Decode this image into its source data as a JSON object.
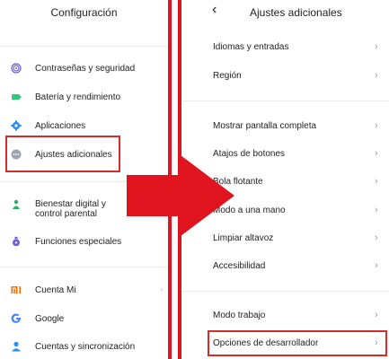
{
  "left_screen": {
    "title": "Configuración",
    "items": [
      {
        "label": "Contraseñas y seguridad",
        "icon": "fingerprint-icon",
        "color": "#6a5acd"
      },
      {
        "label": "Batería y rendimiento",
        "icon": "battery-icon",
        "color": "#2ecc71"
      },
      {
        "label": "Aplicaciones",
        "icon": "gear-icon",
        "color": "#2d8cf0"
      },
      {
        "label": "Ajustes adicionales",
        "icon": "more-dots-icon",
        "color": "#9aa5b1"
      },
      {
        "label": "Bienestar digital y control parental",
        "icon": "wellbeing-icon",
        "color": "#27ae60"
      },
      {
        "label": "Funciones especiales",
        "icon": "special-features-icon",
        "color": "#6c5ce7"
      },
      {
        "label": "Cuenta Mi",
        "icon": "mi-logo-icon",
        "color": "#ff6a00"
      },
      {
        "label": "Google",
        "icon": "google-icon",
        "color": "#4285f4"
      },
      {
        "label": "Cuentas y sincronización",
        "icon": "person-icon",
        "color": "#1e90ff"
      }
    ]
  },
  "right_screen": {
    "back_icon": "back-arrow-icon",
    "title": "Ajustes adicionales",
    "items": [
      {
        "label": "Idiomas y entradas"
      },
      {
        "label": "Región"
      },
      {
        "label": "Mostrar pantalla completa"
      },
      {
        "label": "Atajos de botones"
      },
      {
        "label": "Bola flotante"
      },
      {
        "label": "Modo a una mano"
      },
      {
        "label": "Limpiar altavoz"
      },
      {
        "label": "Accesibilidad"
      },
      {
        "label": "Modo trabajo"
      },
      {
        "label": "Opciones de desarrollador"
      }
    ],
    "chevron": "›"
  },
  "annotation": {
    "highlight_color": "#d62b2b",
    "arrow_color": "#e0141e",
    "arrow_icon": "right-arrow-icon"
  }
}
